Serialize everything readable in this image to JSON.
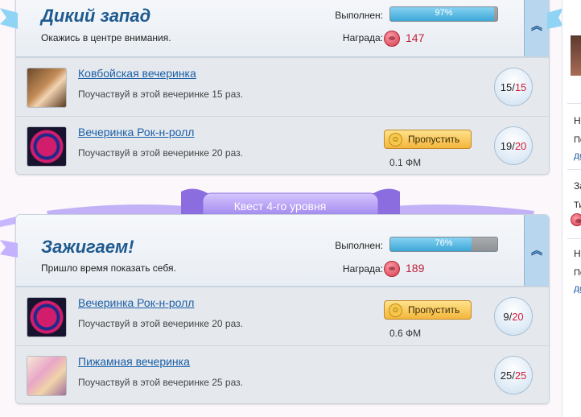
{
  "quests": [
    {
      "title": "Дикий запад",
      "subtitle": "Окажись в центре внимания.",
      "progress_label": "Выполнен:",
      "progress_text": "97%",
      "progress": 0.97,
      "reward_label": "Награда:",
      "reward_value": "147",
      "parties": [
        {
          "name": "Ковбойская вечеринка",
          "desc": "Поучаствуй в этой вечеринке 15 раз.",
          "done": "15",
          "total": "15"
        },
        {
          "name": "Вечеринка Рок-н-ролл",
          "desc": "Поучаствуй в этой вечеринке 20 раз.",
          "done": "19",
          "total": "20",
          "skip_label": "Пропустить",
          "skip_cost": "0.1 ФМ"
        }
      ]
    },
    {
      "title": "Зажигаем!",
      "subtitle": "Пришло время показать себя.",
      "progress_label": "Выполнен:",
      "progress_text": "76%",
      "progress": 0.76,
      "reward_label": "Награда:",
      "reward_value": "189",
      "parties": [
        {
          "name": "Вечеринка Рок-н-ролл",
          "desc": "Поучаствуй в этой вечеринке 20 раз.",
          "done": "9",
          "total": "20",
          "skip_label": "Пропустить",
          "skip_cost": "0.6 ФМ"
        },
        {
          "name": "Пижамная вечеринка",
          "desc": "Поучаствуй в этой вечеринке 25 раз.",
          "done": "25",
          "total": "25"
        }
      ]
    }
  ],
  "ribbon_label": "Квест 4-го уровня",
  "right_column": {
    "fragments": [
      "Н",
      "По",
      "до",
      "За",
      "Ти",
      "Н",
      "По",
      "до"
    ]
  },
  "colors": {
    "title": "#1f5a8f",
    "reward": "#c0203a",
    "ribbon": "#a98cf0",
    "progress_fill": "#3ea6d6"
  }
}
